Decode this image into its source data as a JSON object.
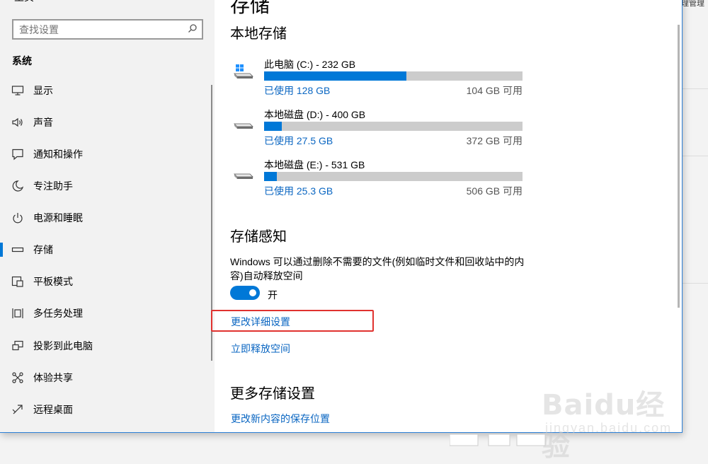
{
  "background": {
    "right_text": "理管理"
  },
  "sidebar": {
    "top_label": "主页",
    "search_placeholder": "查找设置",
    "section": "系统",
    "items": [
      {
        "label": "显示",
        "icon": "monitor-icon"
      },
      {
        "label": "声音",
        "icon": "speaker-icon"
      },
      {
        "label": "通知和操作",
        "icon": "notification-icon"
      },
      {
        "label": "专注助手",
        "icon": "moon-icon"
      },
      {
        "label": "电源和睡眠",
        "icon": "power-icon"
      },
      {
        "label": "存储",
        "icon": "storage-icon",
        "active": true
      },
      {
        "label": "平板模式",
        "icon": "tablet-icon"
      },
      {
        "label": "多任务处理",
        "icon": "multitask-icon"
      },
      {
        "label": "投影到此电脑",
        "icon": "project-icon"
      },
      {
        "label": "体验共享",
        "icon": "share-icon"
      },
      {
        "label": "远程桌面",
        "icon": "remote-icon"
      }
    ]
  },
  "main": {
    "title": "存储",
    "local_storage": {
      "heading": "本地存储",
      "drives": [
        {
          "name": "此电脑 (C:) - 232 GB",
          "used": "已使用 128 GB",
          "free": "104 GB 可用",
          "fraction": 0.552,
          "icon": "windows-drive-icon"
        },
        {
          "name": "本地磁盘 (D:) - 400 GB",
          "used": "已使用 27.5 GB",
          "free": "372 GB 可用",
          "fraction": 0.069,
          "icon": "drive-icon"
        },
        {
          "name": "本地磁盘 (E:) - 531 GB",
          "used": "已使用 25.3 GB",
          "free": "506 GB 可用",
          "fraction": 0.048,
          "icon": "drive-icon"
        }
      ]
    },
    "storage_sense": {
      "heading": "存储感知",
      "description": "Windows 可以通过删除不需要的文件(例如临时文件和回收站中的内容)自动释放空间",
      "toggle_on": true,
      "toggle_label": "开",
      "change_settings_link": "更改详细设置",
      "free_now_link": "立即释放空间"
    },
    "more_settings": {
      "heading": "更多存储设置",
      "save_location_link": "更改新内容的保存位置"
    }
  },
  "watermark": {
    "brand": "Baidu经验",
    "url": "jingyan.baidu.com"
  },
  "colors": {
    "accent": "#0078d7",
    "highlight_box": "#e0322f",
    "link": "#0a66c2"
  }
}
